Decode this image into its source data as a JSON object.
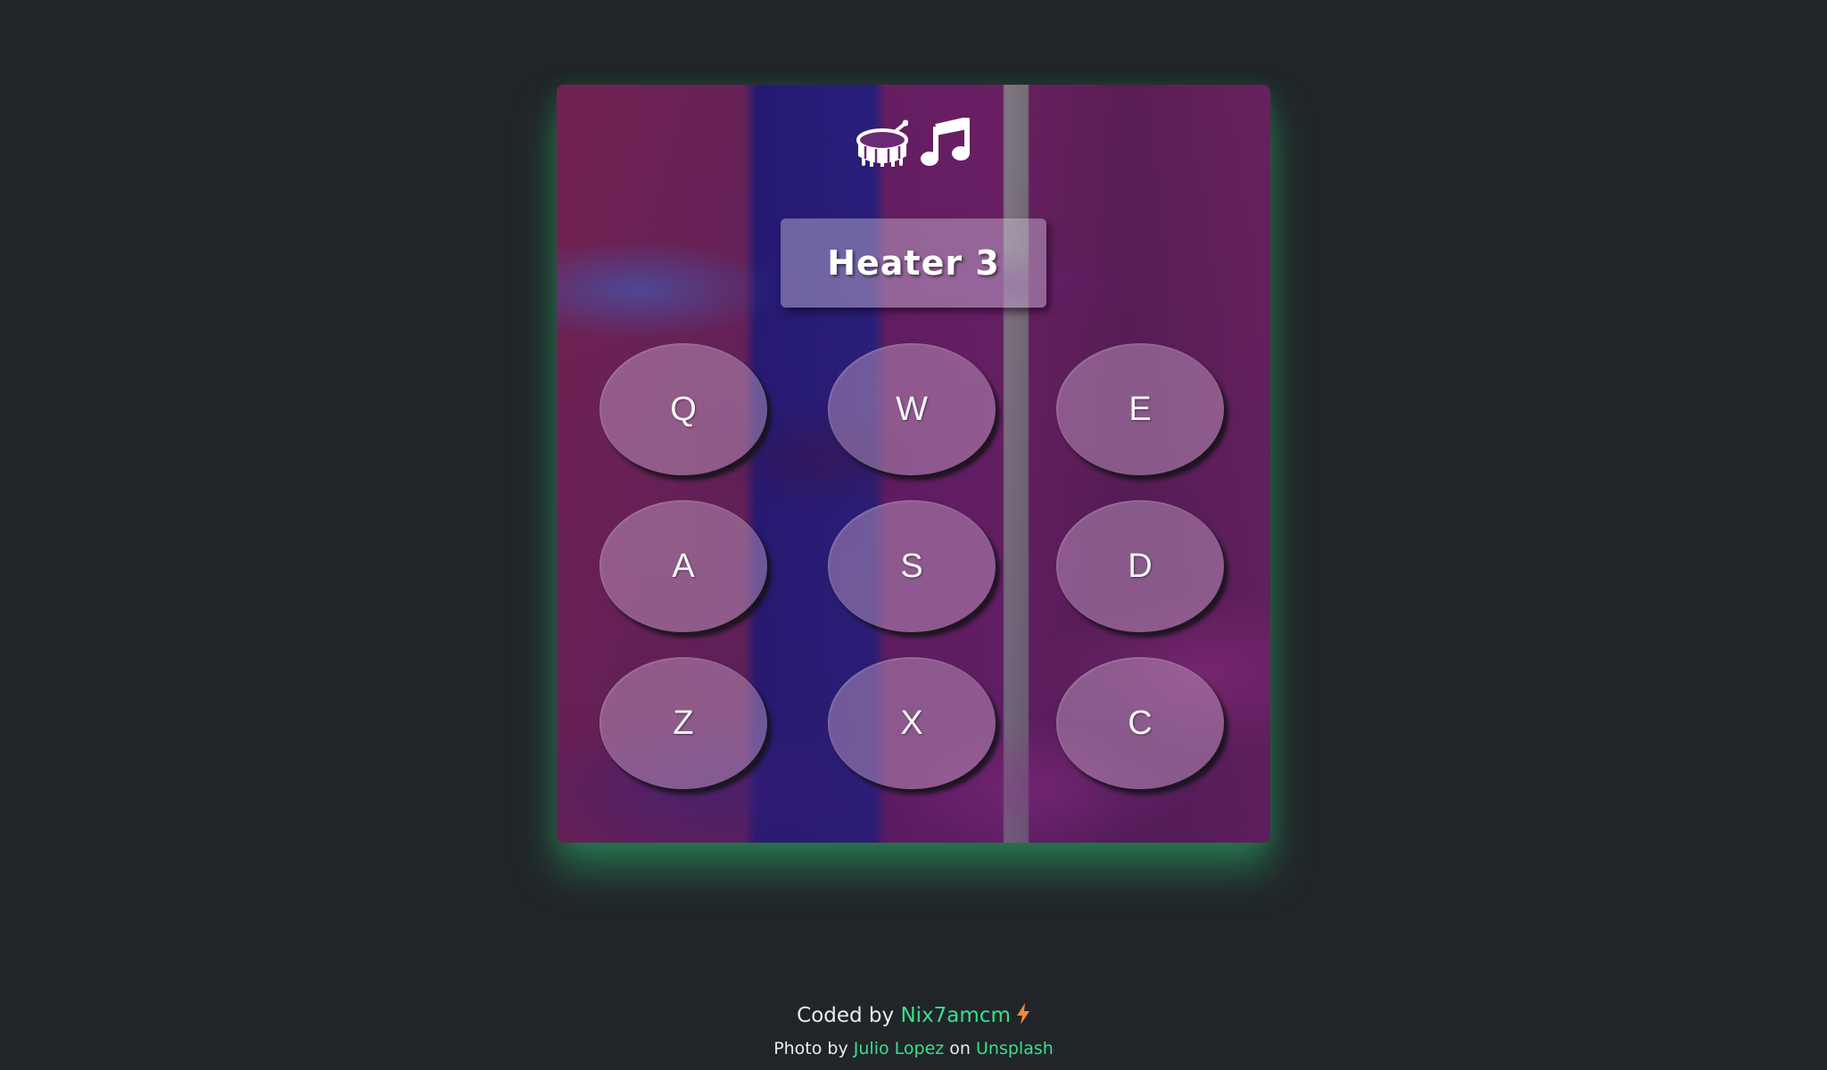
{
  "display": {
    "text": "Heater 3"
  },
  "pads": [
    {
      "key": "Q"
    },
    {
      "key": "W"
    },
    {
      "key": "E"
    },
    {
      "key": "A"
    },
    {
      "key": "S"
    },
    {
      "key": "D"
    },
    {
      "key": "Z"
    },
    {
      "key": "X"
    },
    {
      "key": "C"
    }
  ],
  "header": {
    "icons": [
      "drum-icon",
      "music-note-icon"
    ]
  },
  "footer": {
    "coded_prefix": "Coded by",
    "author": "Nix7amcm",
    "photo_prefix": "Photo by",
    "photographer": "Julio Lopez",
    "on_text": "on",
    "source": "Unsplash",
    "bolt_icon": "bolt-icon"
  },
  "colors": {
    "background": "#212529",
    "link": "#38e08c",
    "glow": "#2ba868",
    "bolt": "#f08a3c"
  }
}
